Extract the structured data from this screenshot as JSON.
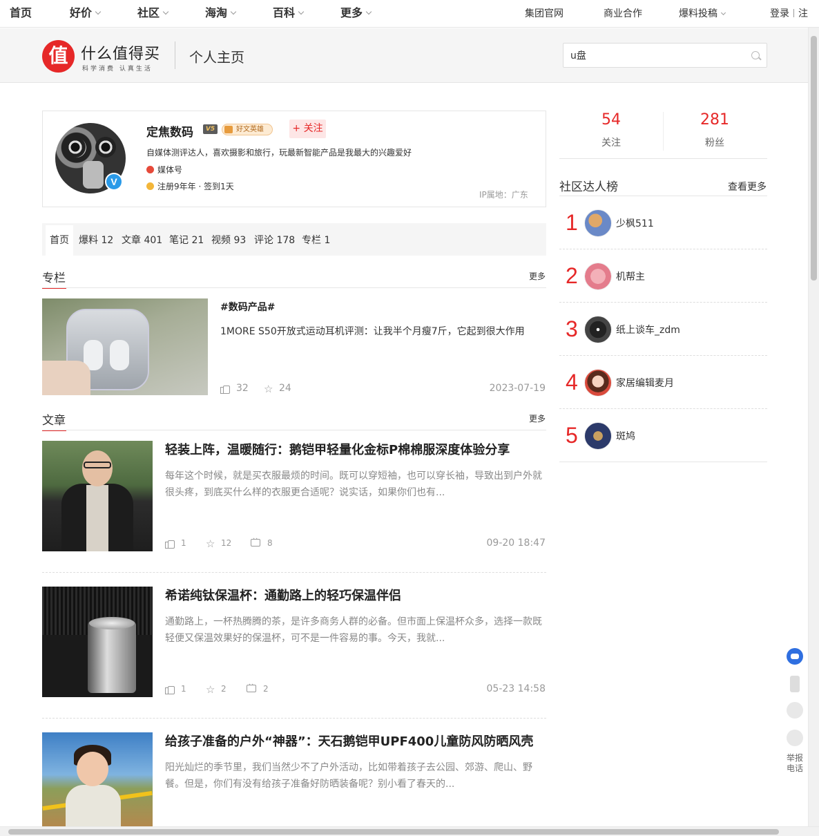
{
  "topnav": {
    "left": [
      {
        "label": "首页",
        "chev": false
      },
      {
        "label": "好价",
        "chev": true
      },
      {
        "label": "社区",
        "chev": true
      },
      {
        "label": "海淘",
        "chev": true
      },
      {
        "label": "百科",
        "chev": true
      },
      {
        "label": "更多",
        "chev": true
      }
    ],
    "right": {
      "group": "集团官网",
      "business": "商业合作",
      "submit": "爆料投稿",
      "login": "登录",
      "register": "注"
    }
  },
  "header": {
    "logo_char": "值",
    "site_name": "什么值得买",
    "slogan": "科学消费 认真生活",
    "page_name": "个人主页",
    "search": {
      "value": "u盘",
      "icon": "search-icon"
    }
  },
  "profile": {
    "name": "定焦数码",
    "level": "V5",
    "honor_badge": "好文英雄",
    "follow_label": "+ 关注",
    "verified_mark": "V",
    "bio": "自媒体测评达人，喜欢摄影和旅行，玩最新智能产品是我最大的兴趣爱好",
    "media_label": "媒体号",
    "register_info": "注册9年年 · 签到1天",
    "ip_location": "IP属地：广东"
  },
  "tabs": [
    {
      "label": "首页"
    },
    {
      "label": "爆料 12"
    },
    {
      "label": "文章 401"
    },
    {
      "label": "笔记 21"
    },
    {
      "label": "视频 93"
    },
    {
      "label": "评论 178"
    },
    {
      "label": "专栏 1"
    }
  ],
  "column_section": {
    "title": "专栏",
    "more": "更多",
    "item": {
      "tag": "#数码产品#",
      "text": "1MORE S50开放式运动耳机评测：让我半个月瘦7斤，它起到很大作用",
      "likes": "32",
      "favs": "24",
      "date": "2023-07-19"
    }
  },
  "article_section": {
    "title": "文章",
    "more": "更多",
    "items": [
      {
        "title": "轻装上阵，温暖随行：鹅铠甲轻量化金标P棉棉服深度体验分享",
        "desc": "每年这个时候，就是买衣服最烦的时间。既可以穿短袖，也可以穿长袖，导致出到户外就很头疼，到底买什么样的衣服更合适呢？说实话，如果你们也有...",
        "likes": "1",
        "favs": "12",
        "comments": "8",
        "date": "09-20 18:47"
      },
      {
        "title": "希诺纯钛保温杯：通勤路上的轻巧保温伴侣",
        "desc": "通勤路上，一杯热腾腾的茶，是许多商务人群的必备。但市面上保温杯众多，选择一款既轻便又保温效果好的保温杯，可不是一件容易的事。今天，我就...",
        "likes": "1",
        "favs": "2",
        "comments": "2",
        "date": "05-23 14:58"
      },
      {
        "title": "给孩子准备的户外“神器”：天石鹅铠甲UPF400儿童防风防晒风壳",
        "desc": "阳光灿烂的季节里，我们当然少不了户外活动，比如带着孩子去公园、郊游、爬山、野餐。但是，你们有没有给孩子准备好防晒装备呢？别小看了春天的..."
      }
    ]
  },
  "sidebar": {
    "following": {
      "value": "54",
      "label": "关注"
    },
    "fans": {
      "value": "281",
      "label": "粉丝"
    },
    "rank_title": "社区达人榜",
    "rank_more": "查看更多",
    "rank": [
      {
        "num": "1",
        "name": "少枫511"
      },
      {
        "num": "2",
        "name": "机帮主"
      },
      {
        "num": "3",
        "name": "纸上谈车_zdm"
      },
      {
        "num": "4",
        "name": "家居编辑麦月"
      },
      {
        "num": "5",
        "name": "斑鸠"
      }
    ]
  },
  "float_tools": {
    "report_line1": "举报",
    "report_line2": "电话"
  },
  "colors": {
    "accent": "#e62828",
    "muted": "#999999",
    "band": "#f5f5f5"
  }
}
